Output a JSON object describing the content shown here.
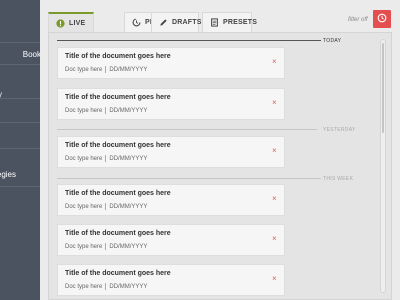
{
  "sidebar": {
    "items": [
      {
        "label": "Book"
      },
      {
        "label": "y"
      },
      {
        "label": ""
      },
      {
        "label": ""
      },
      {
        "label": "egies"
      }
    ]
  },
  "tabs": [
    {
      "label": "LIVE",
      "icon": "exclamation-circle-icon",
      "active": true
    },
    {
      "label": "PENDING",
      "icon": "progress-clock-icon",
      "active": false
    },
    {
      "label": "DRAFTS",
      "icon": "pencil-icon",
      "active": false
    },
    {
      "label": "PRESETS",
      "icon": "document-icon",
      "active": false
    }
  ],
  "filter_label": "filter off",
  "clock_button": {
    "icon": "clock-icon"
  },
  "colors": {
    "accent_green": "#7c9a2b",
    "danger_red": "#e54e4e",
    "sidebar": "#4b5361"
  },
  "sections": [
    {
      "label": "TODAY"
    },
    {
      "label": "YESTERDAY"
    },
    {
      "label": "THIS WEEK"
    }
  ],
  "cards": [
    {
      "title": "Title of the document goes here",
      "type": "Doc type here",
      "date": "DD/MM/YYYY"
    },
    {
      "title": "Title of the document goes here",
      "type": "Doc type here",
      "date": "DD/MM/YYYY"
    },
    {
      "title": "Title of the document goes here",
      "type": "Doc type here",
      "date": "DD/MM/YYYY"
    },
    {
      "title": "Title of the document goes here",
      "type": "Doc type here",
      "date": "DD/MM/YYYY"
    },
    {
      "title": "Title of the document goes here",
      "type": "Doc type here",
      "date": "DD/MM/YYYY"
    },
    {
      "title": "Title of the document goes here",
      "type": "Doc type here",
      "date": "DD/MM/YYYY"
    }
  ],
  "delete_glyph": "×"
}
